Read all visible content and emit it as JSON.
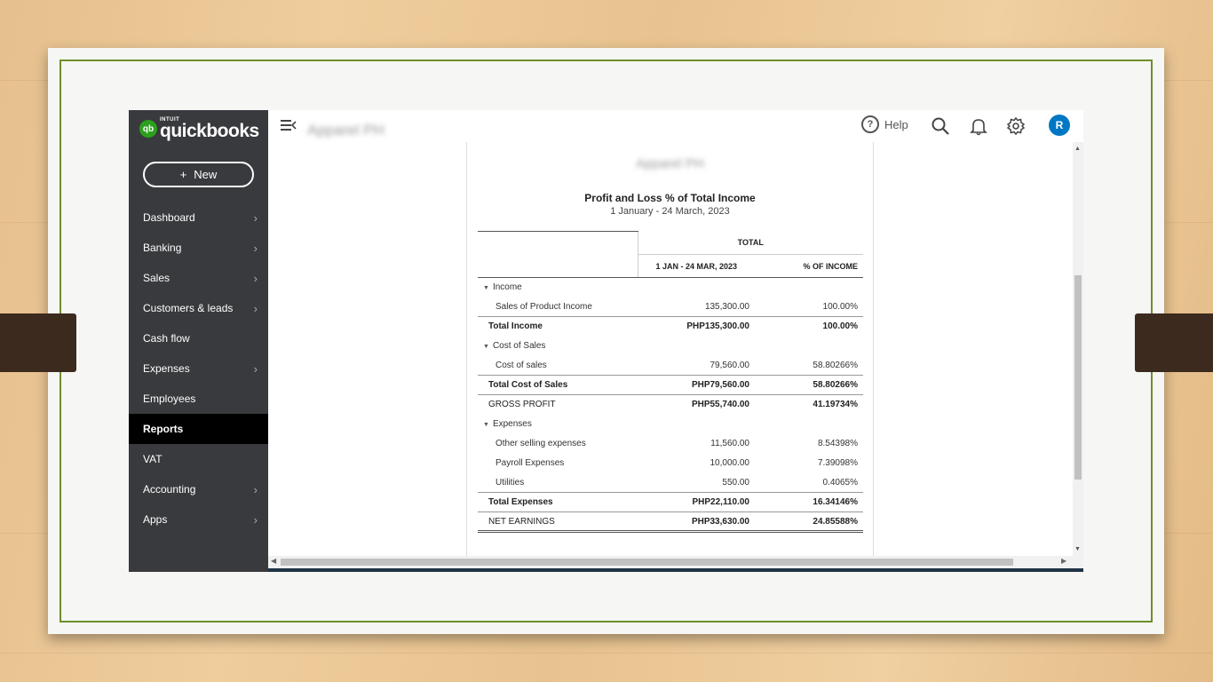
{
  "app": {
    "logo_brand": "intuit",
    "logo_product": "quickbooks",
    "logo_mark": "qb",
    "new_button": "New",
    "new_button_icon": "+",
    "company_name": "Apparel PH"
  },
  "sidebar": {
    "items": [
      {
        "label": "Dashboard",
        "chevron": true,
        "active": false
      },
      {
        "label": "Banking",
        "chevron": true,
        "active": false
      },
      {
        "label": "Sales",
        "chevron": true,
        "active": false
      },
      {
        "label": "Customers & leads",
        "chevron": true,
        "active": false
      },
      {
        "label": "Cash flow",
        "chevron": false,
        "active": false
      },
      {
        "label": "Expenses",
        "chevron": true,
        "active": false
      },
      {
        "label": "Employees",
        "chevron": false,
        "active": false
      },
      {
        "label": "Reports",
        "chevron": false,
        "active": true
      },
      {
        "label": "VAT",
        "chevron": false,
        "active": false
      },
      {
        "label": "Accounting",
        "chevron": true,
        "active": false
      },
      {
        "label": "Apps",
        "chevron": true,
        "active": false
      }
    ]
  },
  "topbar": {
    "help_label": "Help",
    "help_glyph": "?",
    "avatar_initial": "R",
    "icons": [
      "collapse-menu-icon",
      "help-icon",
      "search-icon",
      "bell-icon",
      "gear-icon"
    ],
    "accent": "#0077c5"
  },
  "report": {
    "company": "Apparel PH",
    "title": "Profit and Loss % of Total Income",
    "date_range": "1 January - 24 March, 2023",
    "header_group": "TOTAL",
    "col_period": "1 JAN - 24 MAR, 2023",
    "col_pct": "% OF INCOME",
    "rows": [
      {
        "type": "section",
        "label": "Income",
        "amount": "",
        "pct": ""
      },
      {
        "type": "line",
        "label": "Sales of Product Income",
        "amount": "135,300.00",
        "pct": "100.00%"
      },
      {
        "type": "total",
        "label": "Total Income",
        "amount": "PHP135,300.00",
        "pct": "100.00%"
      },
      {
        "type": "section",
        "label": "Cost of Sales",
        "amount": "",
        "pct": ""
      },
      {
        "type": "line",
        "label": "Cost of sales",
        "amount": "79,560.00",
        "pct": "58.80266%"
      },
      {
        "type": "total",
        "label": "Total Cost of Sales",
        "amount": "PHP79,560.00",
        "pct": "58.80266%"
      },
      {
        "type": "summary",
        "label": "GROSS PROFIT",
        "amount": "PHP55,740.00",
        "pct": "41.19734%"
      },
      {
        "type": "section",
        "label": "Expenses",
        "amount": "",
        "pct": ""
      },
      {
        "type": "line",
        "label": "Other selling expenses",
        "amount": "11,560.00",
        "pct": "8.54398%"
      },
      {
        "type": "line",
        "label": "Payroll Expenses",
        "amount": "10,000.00",
        "pct": "7.39098%"
      },
      {
        "type": "line",
        "label": "Utilities",
        "amount": "550.00",
        "pct": "0.4065%"
      },
      {
        "type": "total",
        "label": "Total Expenses",
        "amount": "PHP22,110.00",
        "pct": "16.34146%"
      },
      {
        "type": "net",
        "label": "NET EARNINGS",
        "amount": "PHP33,630.00",
        "pct": "24.85588%"
      }
    ]
  },
  "colors": {
    "sidebar_bg": "#393a3d",
    "active_item_bg": "#000000",
    "brand_green": "#2ca01c",
    "slide_border": "#6f8f2a"
  }
}
